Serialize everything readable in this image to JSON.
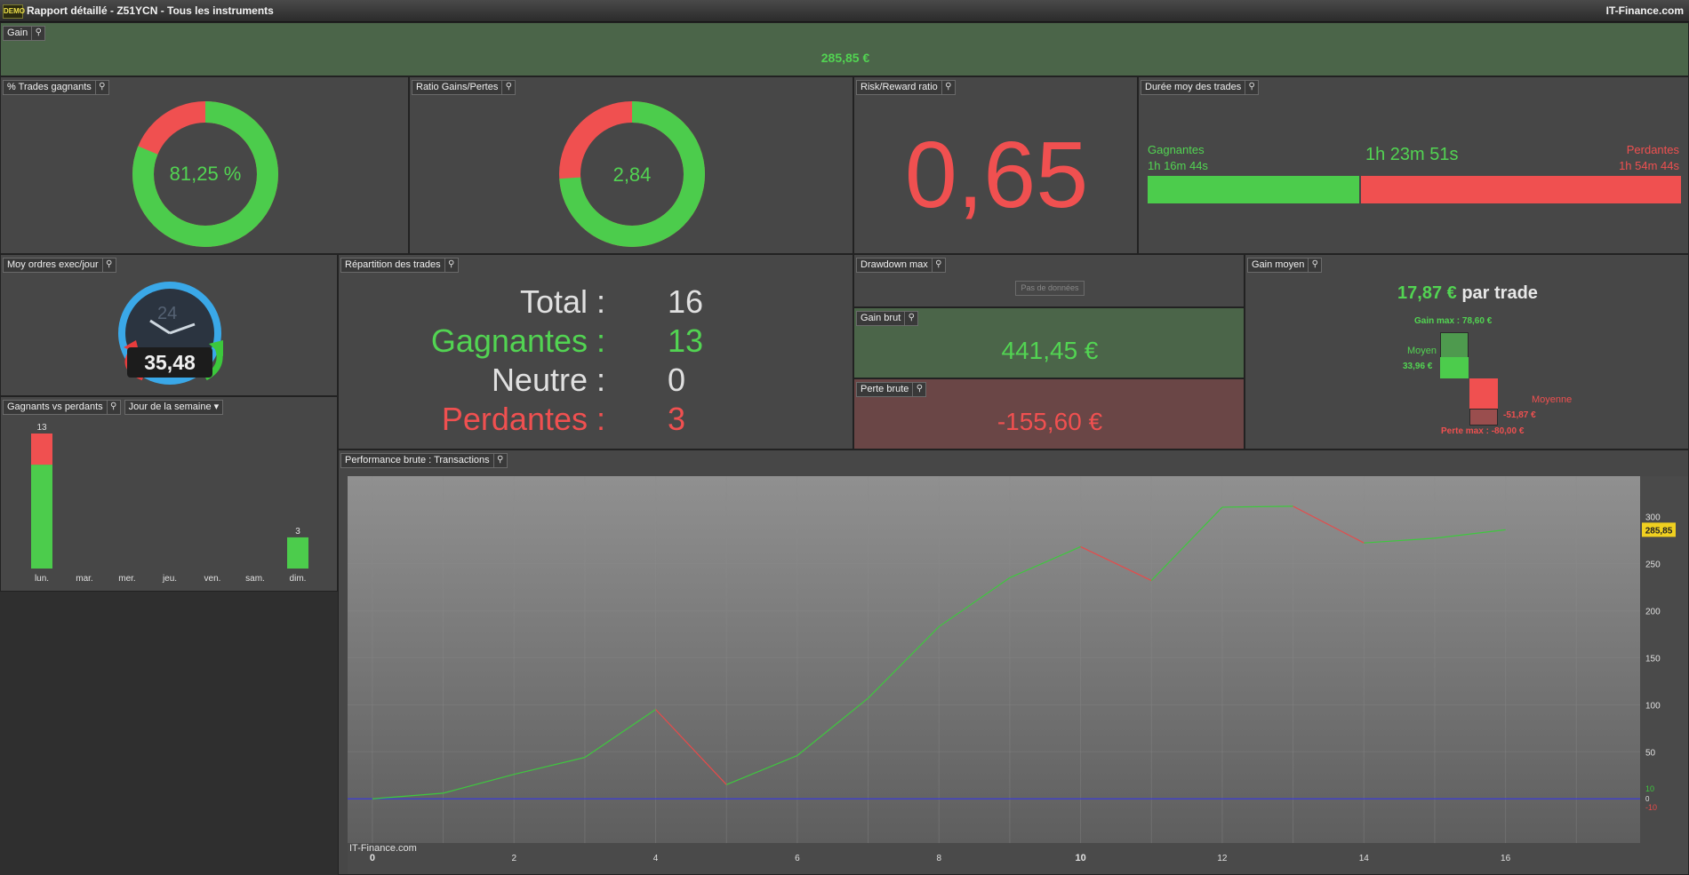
{
  "window": {
    "title": "Rapport détaillé - Z51YCN - Tous les instruments",
    "brand": "IT-Finance.com",
    "logo": "DEMO"
  },
  "gain": {
    "title": "Gain",
    "value": "285,85 €"
  },
  "trades_gagnants": {
    "title": "% Trades gagnants",
    "value": "81,25 %",
    "fraction": 0.8125
  },
  "ratio": {
    "title": "Ratio Gains/Pertes",
    "value": "2,84",
    "fraction": 0.7396
  },
  "rr": {
    "title": "Risk/Reward ratio",
    "value": "0,65"
  },
  "duree": {
    "title": "Durée moy des trades",
    "gagnantes_label": "Gagnantes",
    "gagnantes_value": "1h 16m 44s",
    "moyenne": "1h 23m 51s",
    "perdantes_label": "Perdantes",
    "perdantes_value": "1h 54m 44s",
    "win_fraction": 0.4
  },
  "moy_ordres": {
    "title": "Moy ordres exec/jour",
    "clock": "24",
    "value": "35,48"
  },
  "repartition": {
    "title": "Répartition des trades",
    "rows": [
      {
        "label": "Total :",
        "value": "16",
        "color": "#e0e0e0"
      },
      {
        "label": "Gagnantes :",
        "value": "13",
        "color": "#52d452"
      },
      {
        "label": "Neutre :",
        "value": "0",
        "color": "#e0e0e0"
      },
      {
        "label": "Perdantes :",
        "value": "3",
        "color": "#f05050"
      }
    ]
  },
  "drawdown": {
    "title": "Drawdown max",
    "nodata": "Pas de données"
  },
  "gain_brut": {
    "title": "Gain brut",
    "value": "441,45 €"
  },
  "perte_brute": {
    "title": "Perte brute",
    "value": "-155,60 €"
  },
  "gain_moyen": {
    "title": "Gain moyen",
    "value": "17,87 €",
    "suffix": "par trade",
    "gain_max": "Gain max : 78,60 €",
    "moyen_label": "Moyen",
    "moyen_value": "33,96 €",
    "moyenne_label": "Moyenne",
    "moyenne_value": "-51,87 €",
    "perte_max": "Perte max : -80,00 €"
  },
  "gvp": {
    "title": "Gagnants vs perdants",
    "dropdown": "Jour de la semaine",
    "days": [
      "lun.",
      "mar.",
      "mer.",
      "jeu.",
      "ven.",
      "sam.",
      "dim."
    ],
    "winners": [
      10,
      0,
      0,
      0,
      0,
      0,
      3
    ],
    "losers": [
      3,
      0,
      0,
      0,
      0,
      0,
      0
    ],
    "labels": [
      "13",
      "",
      "",
      "",
      "",
      "",
      "3"
    ],
    "max": 13
  },
  "perf": {
    "title": "Performance brute : Transactions",
    "watermark": "IT-Finance.com",
    "last_label": "285,85",
    "chart_data": {
      "type": "line",
      "x": [
        0,
        1,
        2,
        3,
        4,
        5,
        6,
        7,
        8,
        9,
        10,
        11,
        12,
        13,
        14,
        15,
        16
      ],
      "y": [
        0,
        6,
        26,
        44,
        95,
        15,
        46,
        107,
        183,
        235,
        268,
        232,
        310,
        311,
        272,
        277,
        286
      ],
      "x_ticks": [
        "0",
        "2",
        "4",
        "6",
        "8",
        "10",
        "12",
        "14",
        "16"
      ],
      "y_ticks": [
        "50",
        "100",
        "150",
        "200",
        "250",
        "300"
      ],
      "xlim": [
        -0.35,
        17.9
      ],
      "ylim": [
        -47,
        343
      ],
      "zero_labels": [
        "10",
        "0",
        "-10"
      ]
    }
  }
}
